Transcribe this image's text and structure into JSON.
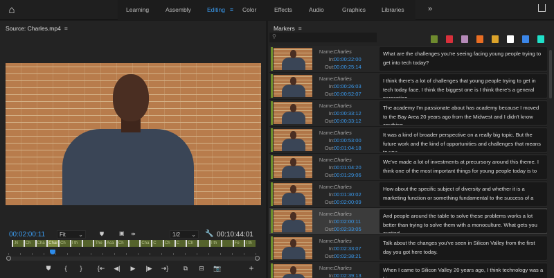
{
  "topbar": {
    "tabs": [
      "Learning",
      "Assembly",
      "Editing",
      "Color",
      "Effects",
      "Audio",
      "Graphics",
      "Libraries"
    ],
    "active": "Editing",
    "more": "»"
  },
  "source": {
    "title": "Source: Charles.mp4",
    "timecode": "00:02:00:11",
    "zoom": "Fit",
    "resolution": "1/2",
    "duration": "00:10:44:01",
    "segments": [
      ".N",
      "Ch",
      "Cha",
      "Char",
      "Ch",
      "I th",
      "",
      "The",
      "Aca",
      "Ch",
      "",
      "Cha",
      "C",
      "Ch",
      "C",
      "Ch",
      "",
      "I th",
      "",
      "Fo",
      "I th"
    ]
  },
  "markers": {
    "title": "Markers",
    "search_placeholder": "",
    "colors": [
      "#6e8a2e",
      "#d9303b",
      "#b58ab8",
      "#ea6e23",
      "#dba32a",
      "#ffffff",
      "#3b86e8",
      "#1fe0c8"
    ],
    "labels": {
      "name": "Name:",
      "in": "In:",
      "out": "Out:"
    },
    "items": [
      {
        "name": "Charles",
        "in": "00:00:22:00",
        "out": "00:00:25:14",
        "text": "What are the challenges you're seeing facing young people trying to get into tech today?"
      },
      {
        "name": "Charles",
        "in": "00:00:26:03",
        "out": "00:00:52:07",
        "text": "I think there's a lot of challenges that young people trying to get in tech today face. I think the biggest one is I think there's a general perception"
      },
      {
        "name": "Charles",
        "in": "00:00:33:12",
        "out": "00:00:33:12",
        "text": "The academy I'm passionate about has academy because I moved to the Bay Area 20 years ago from the Midwest and I didn't know anything"
      },
      {
        "name": "Charles",
        "in": "00:00:53:00",
        "out": "00:01:04:18",
        "text": "It was a kind of broader perspective on a really big topic. But the future work and the kind of opportunities and challenges that means to you,"
      },
      {
        "name": "Charles",
        "in": "00:01:04:20",
        "out": "00:01:29:06",
        "text": "We've made a lot of investments at precursory around this theme. I think one of the most important things for young people today is to"
      },
      {
        "name": "Charles",
        "in": "00:01:30:02",
        "out": "00:02:00:09",
        "text": "How about the specific subject of diversity and whether it is a marketing function or something fundamental to the success of a"
      },
      {
        "name": "Charles",
        "in": "00:02:00:11",
        "out": "00:02:33:05",
        "text": "And people around the table to solve these problems works a lot better than trying to solve them with a monoculture. What gets you excited"
      },
      {
        "name": "Charles",
        "in": "00:02:33:07",
        "out": "00:02:38:21",
        "text": "Talk about the changes you've seen in Silicon Valley from the first day you got here today."
      },
      {
        "name": "Charles",
        "in": "00:02:39:13",
        "out": "",
        "text": "When I came to Silicon Valley 20 years ago, I think technology was a big"
      }
    ]
  }
}
